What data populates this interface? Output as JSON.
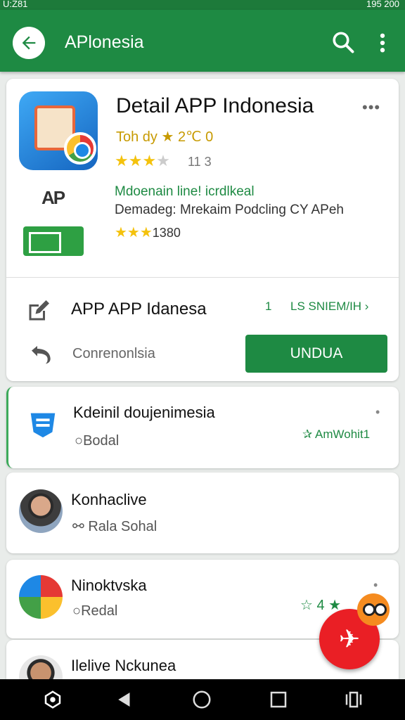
{
  "status_bar": {
    "left_text": "U:Z81",
    "right_text": "195 200"
  },
  "app_bar": {
    "title": "APlonesia",
    "back_icon": "arrow-left-icon",
    "search_icon": "search-icon",
    "more_icon": "more-vert-icon"
  },
  "app_detail": {
    "title": "Detail APP Indonesia",
    "today_label": "Toh dy",
    "today_star": "★",
    "today_value": "2℃ 0",
    "rating_count": "11 3",
    "subtitle": "Mdoenain line! icrdlkeal",
    "developer": "Demadeg: Mrekaim Podcling CY APeh",
    "stars_count": "1380",
    "ap_logo": "AP",
    "overflow": "•••"
  },
  "action_section": {
    "app_name": "APP APP Idanesa",
    "count": "1",
    "see_all": "LS SNIEM/IH ›",
    "convert_label": "Conrenonlsia",
    "download_button": "UNDUA"
  },
  "list_items": [
    {
      "title": "Kdeinil doujenimesia",
      "subtitle": "Bodal",
      "badge": "✰ AmWohit1",
      "dot": "•"
    },
    {
      "title": "Konhaclive",
      "subtitle": "Rala Sohal"
    },
    {
      "title": "Ninoktvska",
      "subtitle": "Redal",
      "badge": "☆ 4 ★",
      "dot": "•"
    },
    {
      "title": "Ilelive Nckunea"
    }
  ],
  "colors": {
    "primary_green": "#1e8a43",
    "fab_red": "#ea1f25",
    "star_gold": "#f4c20d"
  }
}
